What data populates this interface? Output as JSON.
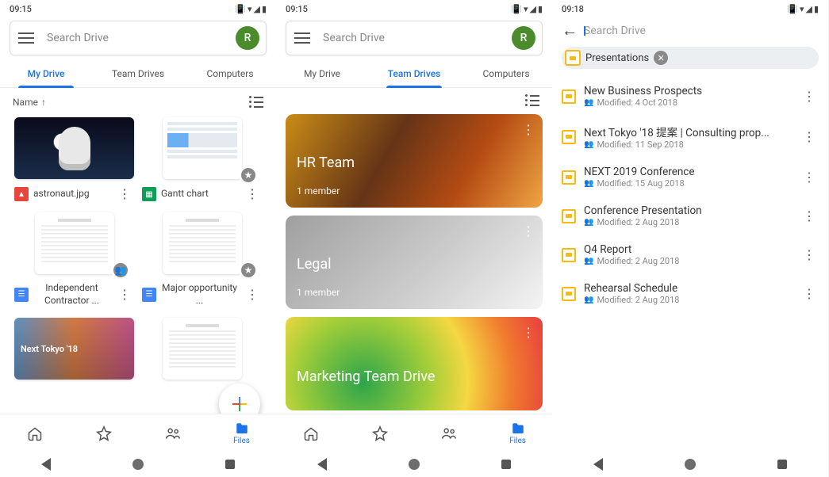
{
  "status": {
    "time1": "09:15",
    "time2": "09:15",
    "time3": "09:18"
  },
  "search": {
    "placeholder": "Search Drive",
    "avatar_letter": "R"
  },
  "tabs": [
    "My Drive",
    "Team Drives",
    "Computers"
  ],
  "sort": {
    "label": "Name",
    "arrow": "↑"
  },
  "files": [
    {
      "name": "astronaut.jpg",
      "type": "image",
      "badge": ""
    },
    {
      "name": "Gantt chart",
      "type": "sheet",
      "badge": "★"
    },
    {
      "name": "Independent Contractor ...",
      "type": "docf",
      "badge": "👥"
    },
    {
      "name": "Major opportunity ...",
      "type": "docf",
      "badge": "★"
    },
    {
      "name": "Next Tokyo '18",
      "type": "slide",
      "badge": ""
    },
    {
      "name": "",
      "type": "docf",
      "badge": ""
    }
  ],
  "team_drives": [
    {
      "name": "HR Team",
      "sub": "1 member"
    },
    {
      "name": "Legal",
      "sub": "1 member"
    },
    {
      "name": "Marketing Team Drive",
      "sub": ""
    }
  ],
  "filter_chip": "Presentations",
  "results": [
    {
      "title": "New Business Prospects",
      "sub": "Modified: 4 Oct 2018"
    },
    {
      "title": "Next Tokyo '18 提案 | Consulting prop...",
      "sub": "Modified: 11 Sep 2018"
    },
    {
      "title": "NEXT 2019 Conference",
      "sub": "Modified: 15 Aug 2018"
    },
    {
      "title": "Conference Presentation",
      "sub": "Modified: 2 Aug 2018"
    },
    {
      "title": "Q4 Report",
      "sub": "Modified: 2 Aug 2018"
    },
    {
      "title": "Rehearsal Schedule",
      "sub": "Modified: 2 Aug 2018"
    }
  ],
  "nav": {
    "files_label": "Files"
  }
}
